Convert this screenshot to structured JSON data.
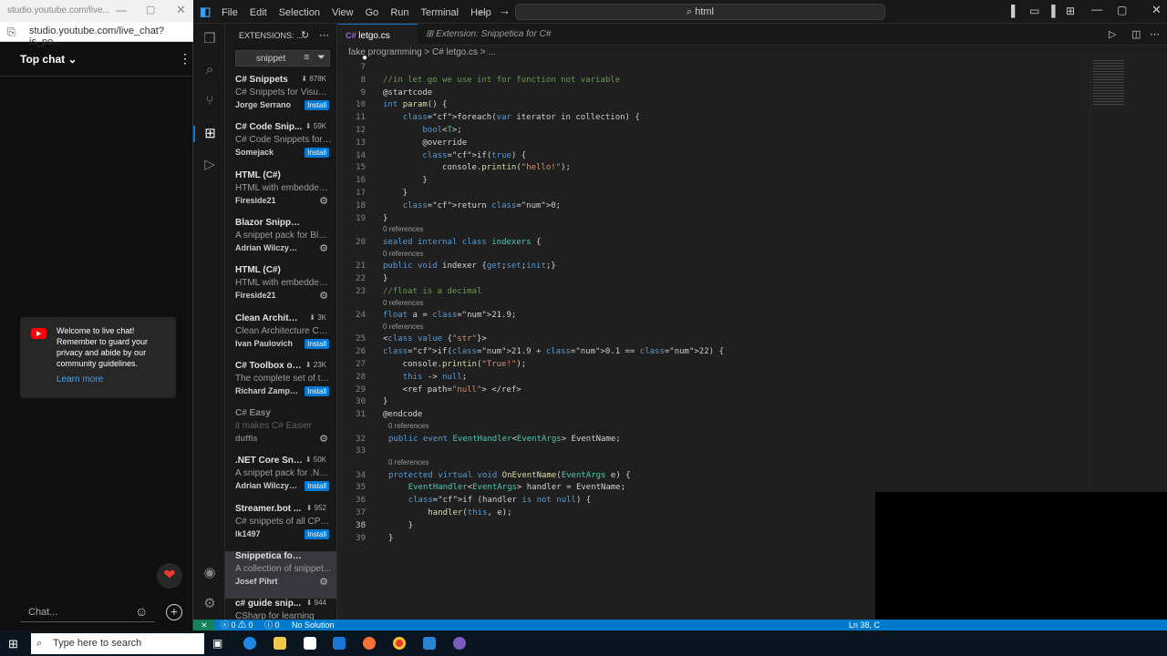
{
  "browser": {
    "url": "studio.youtube.com/live_chat?is_po...",
    "title_url": "studio.youtube.com/live..."
  },
  "chat": {
    "header": "Top chat",
    "welcome_text": "Welcome to live chat! Remember to guard your privacy and abide by our community guidelines.",
    "learn_more": "Learn more",
    "input_placeholder": "Chat..."
  },
  "menu": [
    "File",
    "Edit",
    "Selection",
    "View",
    "Go",
    "Run",
    "Terminal",
    "Help"
  ],
  "command_center": "html",
  "sidebar": {
    "title": "EXTENSIONS: ...",
    "search": "snippet",
    "items": [
      {
        "name": "C# Snippets",
        "count": "878K",
        "desc": "C# Snippets for Visual ...",
        "author": "Jorge Serrano",
        "action": "Install"
      },
      {
        "name": "C# Code Snip...",
        "count": "59K",
        "desc": "C# Code Snippets for ...",
        "author": "Somejack",
        "action": "Install"
      },
      {
        "name": "HTML (C#)",
        "count": "",
        "desc": "HTML with embedded ...",
        "author": "Fireside21",
        "action": "gear"
      },
      {
        "name": "Blazor Snippet Pack",
        "count": "",
        "desc": "A snippet pack for Blaz...",
        "author": "Adrian Wilczyński",
        "action": "gear"
      },
      {
        "name": "HTML (C#)",
        "count": "",
        "desc": "HTML with embedded ...",
        "author": "Fireside21",
        "action": "gear"
      },
      {
        "name": "Clean Architec...",
        "count": "3K",
        "desc": "Clean Architecture C# ...",
        "author": "Ivan Paulovich",
        "action": "Install"
      },
      {
        "name": "C# Toolbox of...",
        "count": "23K",
        "desc": "The complete set of to...",
        "author": "Richard Zampieri",
        "action": "Install"
      },
      {
        "name": "C# Easy",
        "count": "",
        "desc": "it makes C# Easier",
        "author": "duffis",
        "action": "gear"
      },
      {
        "name": ".NET Core Sni...",
        "count": "50K",
        "desc": "A snippet pack for .NE...",
        "author": "Adrian Wilczyń...",
        "action": "Install"
      },
      {
        "name": "Streamer.bot ...",
        "count": "952",
        "desc": "C# snippets of all CPH ...",
        "author": "lk1497",
        "action": "Install"
      },
      {
        "name": "Snippetica for C#",
        "count": "",
        "desc": "A collection of snippet...",
        "author": "Josef Pihrt",
        "action": "gear"
      },
      {
        "name": "c# guide snip...",
        "count": "944",
        "desc": "CSharp for learning",
        "author": "",
        "action": ""
      }
    ]
  },
  "tabs": [
    {
      "label": "letgo.cs",
      "active": true,
      "modified": true
    },
    {
      "label": "Extension: Snippetica for C#",
      "active": false
    }
  ],
  "breadcrumb": [
    "fake programming",
    "C# letgo.cs",
    "..."
  ],
  "code": {
    "lines": [
      {
        "n": "7",
        "t": ""
      },
      {
        "n": "8",
        "t": "//in let go we use int for function not variable"
      },
      {
        "n": "9",
        "t": "@startcode"
      },
      {
        "n": "10",
        "t": "int param() {"
      },
      {
        "n": "11",
        "t": "    foreach(var iterator in collection) {"
      },
      {
        "n": "12",
        "t": "        bool<T>;"
      },
      {
        "n": "13",
        "t": "        @override"
      },
      {
        "n": "14",
        "t": "        if(true) {"
      },
      {
        "n": "15",
        "t": "            console.printin(\"hello!\");"
      },
      {
        "n": "16",
        "t": "        }"
      },
      {
        "n": "17",
        "t": "    }"
      },
      {
        "n": "18",
        "t": "    return 0;"
      },
      {
        "n": "19",
        "t": "}"
      },
      {
        "n": "20",
        "t": "sealed internal class indexers {"
      },
      {
        "n": "21",
        "t": "public void indexer {get;set;init;}"
      },
      {
        "n": "22",
        "t": "}"
      },
      {
        "n": "23",
        "t": "//float is a decimal"
      },
      {
        "n": "24",
        "t": "float a = 21.9;"
      },
      {
        "n": "25",
        "t": "<class value {\"str\"}>"
      },
      {
        "n": "26",
        "t": "if(21.9 + 0.1 == 22) {"
      },
      {
        "n": "27",
        "t": "    console.printin(\"True!\");"
      },
      {
        "n": "28",
        "t": "    this -> null;"
      },
      {
        "n": "29",
        "t": "    <ref path=\"null\"> </ref>"
      },
      {
        "n": "30",
        "t": "}"
      },
      {
        "n": "31",
        "t": "@endcode"
      },
      {
        "n": "32",
        "t": "public event EventHandler<EventArgs> EventName;"
      },
      {
        "n": "33",
        "t": ""
      },
      {
        "n": "34",
        "t": "protected virtual void OnEventName(EventArgs e) {"
      },
      {
        "n": "35",
        "t": "    EventHandler<EventArgs> handler = EventName;"
      },
      {
        "n": "36",
        "t": "    if (handler is not null) {"
      },
      {
        "n": "37",
        "t": "        handler(this, e);"
      },
      {
        "n": "38",
        "t": "    }"
      },
      {
        "n": "39",
        "t": "}"
      }
    ],
    "references": "0 references"
  },
  "status": {
    "errors": "0",
    "warnings": "0",
    "info": "0",
    "solution": "No Solution",
    "position": "Ln 38, C"
  },
  "taskbar": {
    "search_placeholder": "Type here to search"
  },
  "colors": {
    "accent": "#007acc",
    "install": "#0078d4",
    "youtube_red": "#ff0000"
  }
}
